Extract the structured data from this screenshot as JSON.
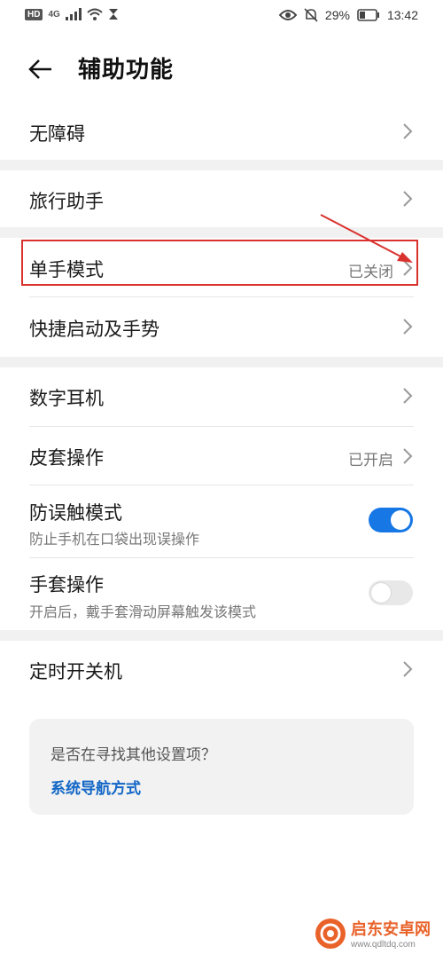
{
  "status_bar": {
    "left": {
      "hd": "HD",
      "network": "4G"
    },
    "right": {
      "battery_percent": "29%",
      "time": "13:42"
    }
  },
  "header": {
    "title": "辅助功能",
    "back_icon": "arrow-left-icon"
  },
  "list": [
    {
      "label": "无障碍"
    },
    {
      "label": "旅行助手"
    },
    {
      "label": "单手模式",
      "value": "已关闭"
    },
    {
      "label": "快捷启动及手势"
    },
    {
      "label": "数字耳机"
    },
    {
      "label": "皮套操作",
      "value": "已开启"
    },
    {
      "label": "防误触模式",
      "subtitle": "防止手机在口袋出现误操作",
      "toggle": "on"
    },
    {
      "label": "手套操作",
      "subtitle": "开启后，戴手套滑动屏幕触发该模式",
      "toggle": "off"
    },
    {
      "label": "定时开关机"
    }
  ],
  "card": {
    "question": "是否在寻找其他设置项？",
    "link": "系统导航方式"
  },
  "watermark": {
    "name": "启东安卓网",
    "url": "www.qdltdq.com"
  },
  "colors": {
    "accent": "#1677e5",
    "link": "#1166c6",
    "annotation": "#d9322e"
  }
}
